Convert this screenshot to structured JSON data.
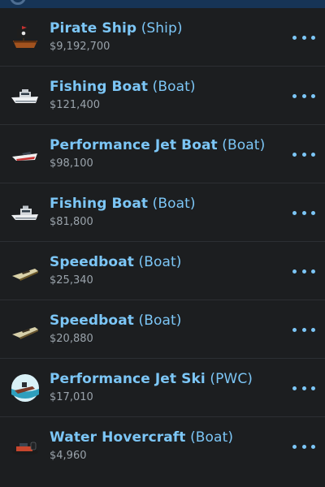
{
  "assets": [
    {
      "name": "Pirate Ship",
      "type": "(Ship)",
      "price": "$9,192,700",
      "icon": "pirate-ship-icon"
    },
    {
      "name": "Fishing Boat",
      "type": "(Boat)",
      "price": "$121,400",
      "icon": "fishing-boat-icon"
    },
    {
      "name": "Performance Jet Boat",
      "type": "(Boat)",
      "price": "$98,100",
      "icon": "jet-boat-icon"
    },
    {
      "name": "Fishing Boat",
      "type": "(Boat)",
      "price": "$81,800",
      "icon": "fishing-boat-icon"
    },
    {
      "name": "Speedboat",
      "type": "(Boat)",
      "price": "$25,340",
      "icon": "speedboat-icon"
    },
    {
      "name": "Speedboat",
      "type": "(Boat)",
      "price": "$20,880",
      "icon": "speedboat-icon"
    },
    {
      "name": "Performance Jet Ski",
      "type": "(PWC)",
      "price": "$17,010",
      "icon": "jet-ski-icon"
    },
    {
      "name": "Water Hovercraft",
      "type": "(Boat)",
      "price": "$4,960",
      "icon": "hovercraft-icon"
    }
  ],
  "colors": {
    "accent": "#7cc6f6",
    "background": "#1c1e20",
    "price_text": "#9aa3ab",
    "top_bar": "#163456"
  }
}
